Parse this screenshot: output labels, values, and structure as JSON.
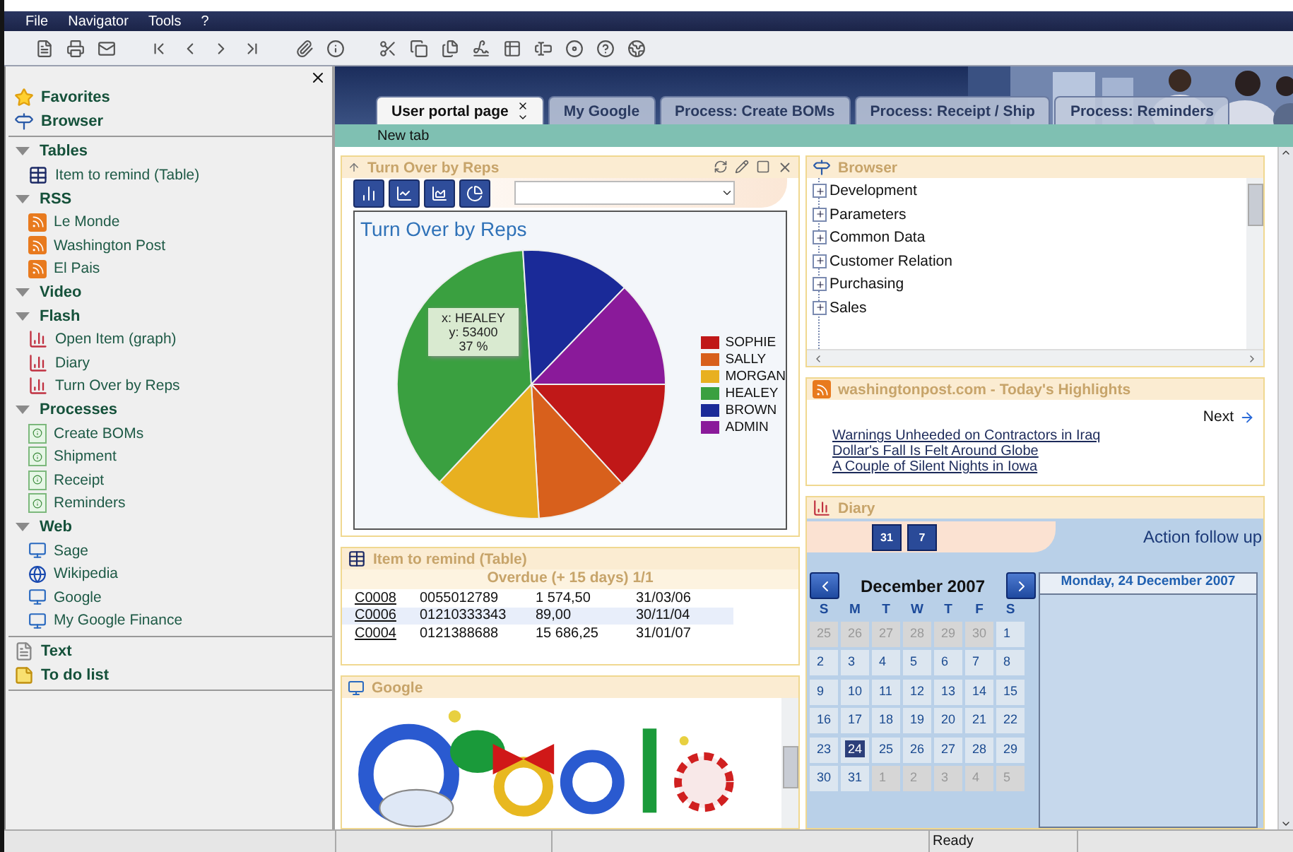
{
  "menu": [
    "File",
    "Navigator",
    "Tools",
    "?"
  ],
  "sidebar": {
    "top": [
      {
        "label": "Favorites",
        "kind": "star"
      },
      {
        "label": "Browser",
        "kind": "signpost"
      }
    ],
    "groups": [
      {
        "label": "Tables",
        "expanded": true,
        "children": [
          {
            "label": "Item to remind (Table)",
            "kind": "table"
          }
        ]
      },
      {
        "label": "RSS",
        "expanded": true,
        "children": [
          {
            "label": "Le Monde",
            "kind": "rss"
          },
          {
            "label": "Washington Post",
            "kind": "rss"
          },
          {
            "label": "El Pais",
            "kind": "rss"
          }
        ]
      },
      {
        "label": "Video",
        "expanded": true
      },
      {
        "label": "Flash",
        "expanded": true,
        "children": [
          {
            "label": "Open Item (graph)",
            "kind": "graph"
          },
          {
            "label": "Diary",
            "kind": "graph"
          },
          {
            "label": "Turn Over by Reps",
            "kind": "graph"
          }
        ]
      },
      {
        "label": "Processes",
        "expanded": true,
        "children": [
          {
            "label": "Create BOMs",
            "kind": "process"
          },
          {
            "label": "Shipment",
            "kind": "process"
          },
          {
            "label": "Receipt",
            "kind": "process"
          },
          {
            "label": "Reminders",
            "kind": "process"
          }
        ]
      },
      {
        "label": "Web",
        "expanded": true,
        "children": [
          {
            "label": "Sage",
            "kind": "web"
          },
          {
            "label": "Wikipedia",
            "kind": "globe"
          },
          {
            "label": "Google",
            "kind": "web"
          },
          {
            "label": "My Google Finance",
            "kind": "web"
          }
        ]
      }
    ],
    "bottom": [
      {
        "label": "Text",
        "kind": "document"
      },
      {
        "label": "To do list",
        "kind": "note"
      }
    ]
  },
  "tabs": [
    {
      "label": "User portal page",
      "selected": true
    },
    {
      "label": "My Google",
      "selected": false
    },
    {
      "label": "Process: Create BOMs",
      "selected": false
    },
    {
      "label": "Process: Receipt / Ship",
      "selected": false
    },
    {
      "label": "Process: Reminders",
      "selected": false
    }
  ],
  "subtab": "New tab",
  "turnover": {
    "title": "Turn Over by Reps",
    "tooltip": [
      "x: HEALEY",
      "y: 53400",
      "37 %"
    ],
    "chart_data": {
      "type": "pie",
      "title": "Turn Over by Reps",
      "categories": [
        "SOPHIE",
        "SALLY",
        "MORGAN",
        "HEALEY",
        "BROWN",
        "ADMIN"
      ],
      "values": [
        13.2,
        10.9,
        12.9,
        37.0,
        13.2,
        12.8
      ],
      "legend": "right",
      "colors": [
        "#c01818",
        "#d8601c",
        "#e8b020",
        "#3aa040",
        "#1a2a98",
        "#8a1a9a"
      ]
    }
  },
  "remind": {
    "title": "Item to remind (Table)",
    "caption": "Overdue (+ 15 days) 1/1",
    "rows": [
      {
        "code": "C0008",
        "cells": [
          "0055012789",
          "1 574,50",
          "31/03/06"
        ],
        "selected": false
      },
      {
        "code": "C0006",
        "cells": [
          "01210333343",
          "89,00",
          "30/11/04"
        ],
        "selected": true
      },
      {
        "code": "C0004",
        "cells": [
          "0121388688",
          "15 686,25",
          "31/01/07"
        ],
        "selected": false
      }
    ]
  },
  "google": {
    "title": "Google"
  },
  "browser": {
    "title": "Browser",
    "items": [
      {
        "label": "Development",
        "expanded": false
      },
      {
        "label": "Parameters",
        "expanded": false
      },
      {
        "label": "Common Data",
        "expanded": false
      },
      {
        "label": "Customer Relation",
        "expanded": false
      },
      {
        "label": "Purchasing",
        "expanded": false
      },
      {
        "label": "Sales",
        "expanded": false
      }
    ]
  },
  "news": {
    "title": "washingtonpost.com - Today's Highlights",
    "next": "Next",
    "links": [
      "Warnings Unheeded on Contractors in Iraq",
      "Dollar's Fall Is Felt Around Globe",
      "A Couple of Silent Nights in Iowa"
    ]
  },
  "diary": {
    "title": "Diary",
    "views": [
      "31",
      "7"
    ],
    "heading": "Action follow up",
    "month": "December 2007",
    "weekdays": [
      "S",
      "M",
      "T",
      "W",
      "T",
      "F",
      "S"
    ],
    "weeks": [
      [
        {
          "day": "25",
          "outside": true,
          "selected": false
        },
        {
          "day": "26",
          "outside": true,
          "selected": false
        },
        {
          "day": "27",
          "outside": true,
          "selected": false
        },
        {
          "day": "28",
          "outside": true,
          "selected": false
        },
        {
          "day": "29",
          "outside": true,
          "selected": false
        },
        {
          "day": "30",
          "outside": true,
          "selected": false
        },
        {
          "day": "1",
          "outside": false,
          "selected": false
        }
      ],
      [
        {
          "day": "2",
          "outside": false,
          "selected": false
        },
        {
          "day": "3",
          "outside": false,
          "selected": false
        },
        {
          "day": "4",
          "outside": false,
          "selected": false
        },
        {
          "day": "5",
          "outside": false,
          "selected": false
        },
        {
          "day": "6",
          "outside": false,
          "selected": false
        },
        {
          "day": "7",
          "outside": false,
          "selected": false
        },
        {
          "day": "8",
          "outside": false,
          "selected": false
        }
      ],
      [
        {
          "day": "9",
          "outside": false,
          "selected": false
        },
        {
          "day": "10",
          "outside": false,
          "selected": false
        },
        {
          "day": "11",
          "outside": false,
          "selected": false
        },
        {
          "day": "12",
          "outside": false,
          "selected": false
        },
        {
          "day": "13",
          "outside": false,
          "selected": false
        },
        {
          "day": "14",
          "outside": false,
          "selected": false
        },
        {
          "day": "15",
          "outside": false,
          "selected": false
        }
      ],
      [
        {
          "day": "16",
          "outside": false,
          "selected": false
        },
        {
          "day": "17",
          "outside": false,
          "selected": false
        },
        {
          "day": "18",
          "outside": false,
          "selected": false
        },
        {
          "day": "19",
          "outside": false,
          "selected": false
        },
        {
          "day": "20",
          "outside": false,
          "selected": false
        },
        {
          "day": "21",
          "outside": false,
          "selected": false
        },
        {
          "day": "22",
          "outside": false,
          "selected": false
        }
      ],
      [
        {
          "day": "23",
          "outside": false,
          "selected": false
        },
        {
          "day": "24",
          "outside": false,
          "selected": true
        },
        {
          "day": "25",
          "outside": false,
          "selected": false
        },
        {
          "day": "26",
          "outside": false,
          "selected": false
        },
        {
          "day": "27",
          "outside": false,
          "selected": false
        },
        {
          "day": "28",
          "outside": false,
          "selected": false
        },
        {
          "day": "29",
          "outside": false,
          "selected": false
        }
      ],
      [
        {
          "day": "30",
          "outside": false,
          "selected": false
        },
        {
          "day": "31",
          "outside": false,
          "selected": false
        },
        {
          "day": "1",
          "outside": true,
          "selected": false
        },
        {
          "day": "2",
          "outside": true,
          "selected": false
        },
        {
          "day": "3",
          "outside": true,
          "selected": false
        },
        {
          "day": "4",
          "outside": true,
          "selected": false
        },
        {
          "day": "5",
          "outside": true,
          "selected": false
        }
      ]
    ],
    "date": "Monday, 24 December 2007"
  },
  "status": "Ready"
}
